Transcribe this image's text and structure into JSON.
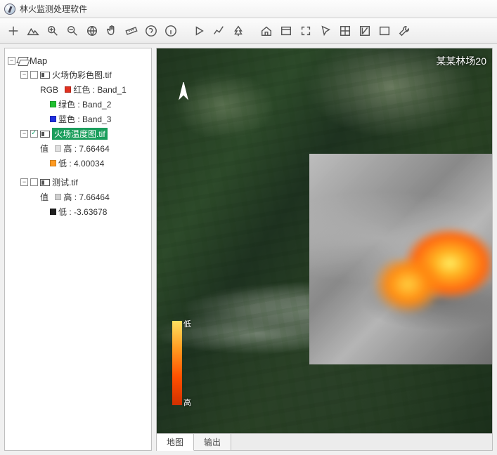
{
  "app": {
    "title": "林火监测处理软件"
  },
  "toolbar_icons": [
    "add",
    "mountain",
    "zoom-in",
    "zoom-out",
    "globe",
    "pan",
    "ruler",
    "help",
    "info",
    "sep",
    "play",
    "chart",
    "tree",
    "sep",
    "home",
    "extent",
    "fullscreen",
    "pointer",
    "grid",
    "north",
    "window",
    "tools"
  ],
  "sidebar": {
    "root": "Map",
    "layers": [
      {
        "name": "火场伪彩色图.tif",
        "checked": false,
        "rgb_label": "RGB",
        "bands": [
          {
            "color": "#e03020",
            "label": "红色",
            "band": "Band_1"
          },
          {
            "color": "#20c030",
            "label": "绿色",
            "band": "Band_2"
          },
          {
            "color": "#2030e0",
            "label": "蓝色",
            "band": "Band_3"
          }
        ]
      },
      {
        "name": "火场温度图.tif",
        "checked": true,
        "selected": true,
        "value_label": "值",
        "stats": [
          {
            "color": "#e0e0e0",
            "label": "高",
            "value": "7.66464"
          },
          {
            "color": "#ff9a20",
            "label": "低",
            "value": "4.00034"
          }
        ]
      },
      {
        "name": "测试.tif",
        "checked": false,
        "value_label": "值",
        "stats": [
          {
            "color": "#d0d0d0",
            "label": "高",
            "value": "7.66464"
          },
          {
            "color": "#202020",
            "label": "低",
            "value": "-3.63678"
          }
        ]
      }
    ]
  },
  "map": {
    "title_partial": "某某林场20",
    "legend": {
      "low": "低",
      "high": "高"
    }
  },
  "tabs": {
    "map": "地图",
    "output": "输出"
  }
}
